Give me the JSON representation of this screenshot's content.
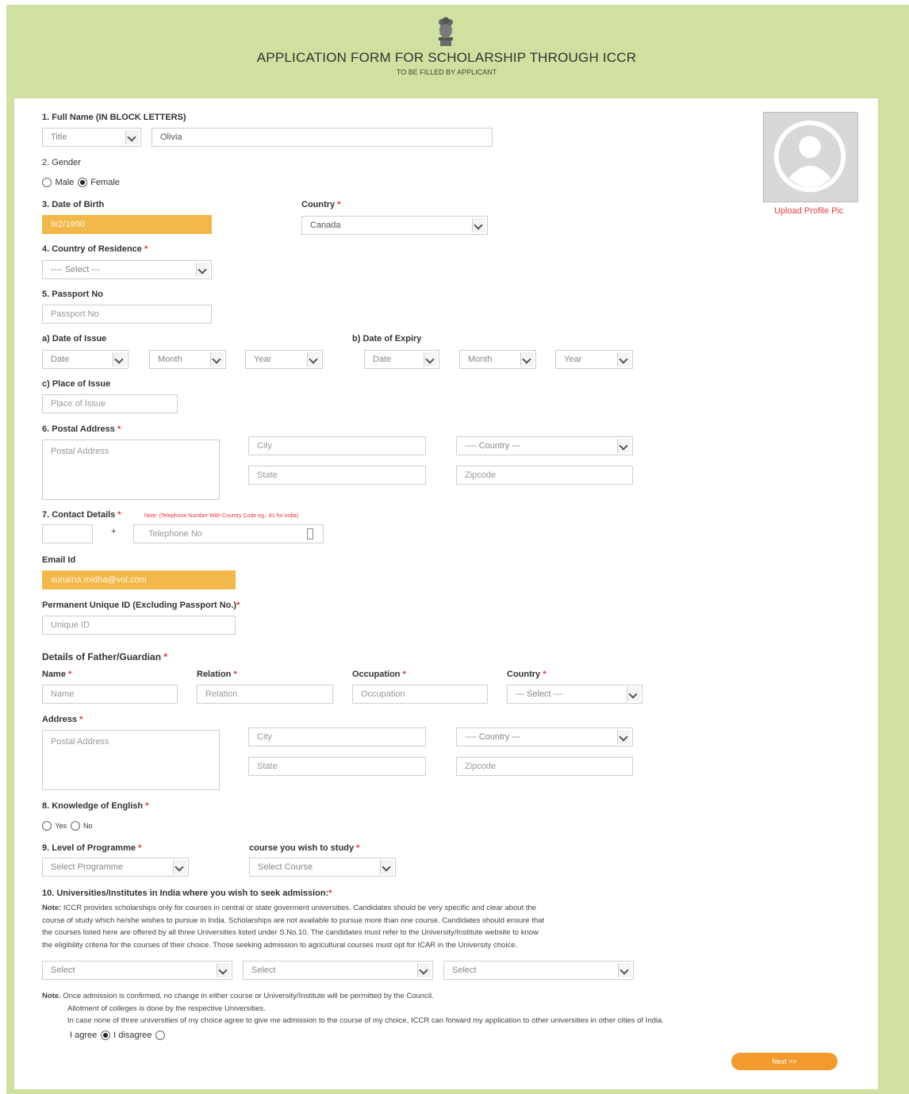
{
  "header": {
    "title": "APPLICATION FORM FOR SCHOLARSHIP THROUGH ICCR",
    "subtitle": "TO BE FILLED BY APPLICANT"
  },
  "profile": {
    "upload_label": "Upload Profile Pic"
  },
  "q1": {
    "label": "1. Full Name (IN BLOCK LETTERS)",
    "title_select": "Title",
    "name_value": "Olivia"
  },
  "q2": {
    "label": "2. Gender",
    "options": [
      "Male",
      "Female"
    ],
    "selected": "Female"
  },
  "q3": {
    "label": "3. Date of Birth",
    "dob_value": "9/2/1990",
    "country_label": "Country",
    "country_value": "Canada"
  },
  "q4": {
    "label": "4. Country of Residence",
    "select_value": "---- Select ---"
  },
  "q5": {
    "label": "5. Passport No",
    "passport_placeholder": "Passport No",
    "issue_label": "a) Date of Issue",
    "expiry_label": "b) Date of Expiry",
    "date": "Date",
    "month": "Month",
    "year": "Year",
    "place_label": "c) Place of Issue",
    "place_placeholder": "Place of Issue"
  },
  "q6": {
    "label": "6. Postal Address",
    "address_placeholder": "Postal Address",
    "city": "City",
    "state": "State",
    "country": "---- Country ---",
    "zipcode": "Zipcode"
  },
  "q7": {
    "label": "7. Contact Details",
    "note": "Note: (Telephone Number With Country Code eg.: 91 for India)",
    "plus": "+",
    "phone_placeholder": "Telephone No",
    "email_label": "Email Id",
    "email_value": "sunaina.midha@vol.com",
    "uid_label": "Permanent Unique ID (Excluding Passport No.)",
    "uid_placeholder": "Unique ID"
  },
  "guardian": {
    "heading": "Details of Father/Guardian",
    "name_label": "Name",
    "name_placeholder": "Name",
    "relation_label": "Relation",
    "relation_placeholder": "Relation",
    "occupation_label": "Occupation",
    "occupation_placeholder": "Occupation",
    "country_label": "Country",
    "country_select": "--- Select ---",
    "address_label": "Address",
    "address_placeholder": "Postal Address",
    "city": "City",
    "state": "State",
    "country": "---- Country ---",
    "zipcode": "Zipcode"
  },
  "q8": {
    "label": "8. Knowledge of English",
    "options": [
      "Yes",
      "No"
    ]
  },
  "q9": {
    "label": "9. Level of Programme",
    "programme_select": "Select Programme",
    "course_label": "course you wish to study",
    "course_select": "Select Course"
  },
  "q10": {
    "label": "10. Universities/Institutes in India where you wish to seek admission:",
    "note_bold": "Note:",
    "note_lines": [
      "ICCR provides scholarships only for courses in central or state goverment universities. Candidates should be very specific and clear about the",
      "course of study which he/she wishes to pursue in India. Scholarships are not available to pursue more than one course. Candidates should ensure that",
      "the courses listed here are offered by all three Universities listed under S.No.10. The candidates must refer to the University/Institute website to know",
      "the eligibility criteria for the courses of their choice. Those seeking admission to agricultural courses must opt for ICAR in the University choice."
    ],
    "selects": [
      "Select",
      "Select",
      "Select"
    ]
  },
  "final_note": {
    "bold": "Note.",
    "line1": "Once admission is confirmed, no change in either course or University/Institute will be permitted by the Council.",
    "line2": "Allotment of colleges is done by the respective Universities.",
    "line3": "In case none of three universities of my choice agree to give me admission to the course of my choice, ICCR can forward my application to other universities in other cities of India.",
    "agree": "I agree",
    "disagree": "I disagree",
    "selected": "agree"
  },
  "next_button": "Next >>"
}
